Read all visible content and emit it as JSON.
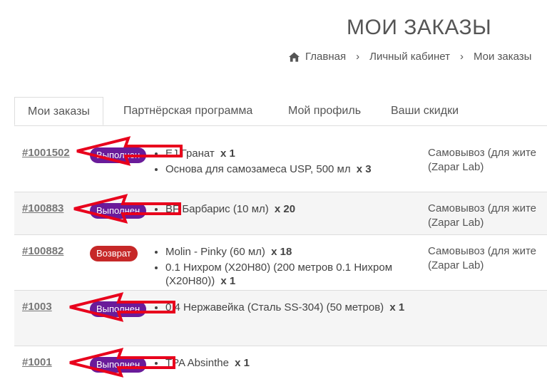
{
  "page_title": "МОИ ЗАКАЗЫ",
  "breadcrumb": {
    "home": "Главная",
    "cabinet": "Личный кабинет",
    "current": "Мои заказы",
    "separator": "›"
  },
  "tabs": [
    {
      "label": "Мои заказы",
      "active": true
    },
    {
      "label": "Партнёрская программа",
      "active": false
    },
    {
      "label": "Мой профиль",
      "active": false
    },
    {
      "label": "Ваши скидки",
      "active": false
    }
  ],
  "orders": [
    {
      "id": "#1001502",
      "status": "Выполнен",
      "items": [
        {
          "name": "EJ Гранат",
          "qty": "x 1"
        },
        {
          "name": "Основа для самозамеса USP, 500 мл",
          "qty": "x 3"
        }
      ],
      "delivery": [
        "Самовывоз (для жите",
        "(Zapar Lab)"
      ]
    },
    {
      "id": "#100883",
      "status": "Выполнен",
      "items": [
        {
          "name": "BF Барбарис (10 мл)",
          "qty": "x 20"
        }
      ],
      "delivery": [
        "Самовывоз (для жите",
        "(Zapar Lab)"
      ]
    },
    {
      "id": "#100882",
      "status": "Возврат",
      "items": [
        {
          "name": "Molin - Pinky (60 мл)",
          "qty": "x 18"
        },
        {
          "name": "0.1 Нихром (X20H80) (200 метров 0.1 Нихром (X20H80))",
          "qty": "x 1"
        }
      ],
      "delivery": [
        "Самовывоз (для жите",
        "(Zapar Lab)"
      ]
    },
    {
      "id": "#1003",
      "status": "Выполнен",
      "items": [
        {
          "name": "0.4 Нержавейка (Сталь SS-304) (50 метров)",
          "qty": "x 1"
        }
      ],
      "delivery": []
    },
    {
      "id": "#1001",
      "status": "Выполнен",
      "items": [
        {
          "name": "TPA Absinthe",
          "qty": "x 1"
        }
      ],
      "delivery": []
    }
  ],
  "colors": {
    "status_done": "#6a1b9a",
    "status_return": "#c62828",
    "annotation_arrow": "#e8001c"
  }
}
